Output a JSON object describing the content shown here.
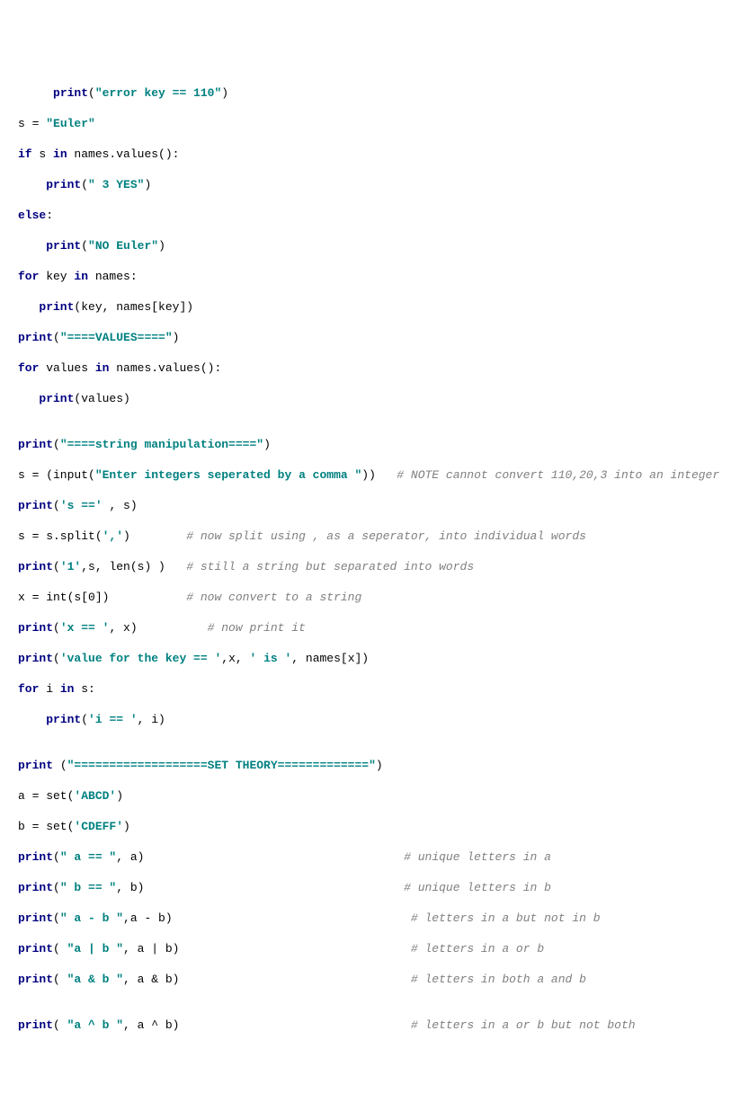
{
  "lines": {
    "l01_indent": "     ",
    "l01_print": "print",
    "l01_p1": "(",
    "l01_str": "\"error key == 110\"",
    "l01_p2": ")",
    "l02_s": "s ",
    "l02_eq": "= ",
    "l02_str": "\"Euler\"",
    "l03_if": "if",
    "l03_mid": " s ",
    "l03_in": "in",
    "l03_rest": " names.values():",
    "l04_indent": "    ",
    "l04_print": "print",
    "l04_p1": "(",
    "l04_str": "\" 3 YES\"",
    "l04_p2": ")",
    "l05_else": "else",
    "l05_colon": ":",
    "l06_indent": "    ",
    "l06_print": "print",
    "l06_p1": "(",
    "l06_str": "\"NO Euler\"",
    "l06_p2": ")",
    "l07_for": "for",
    "l07_mid": " key ",
    "l07_in": "in",
    "l07_rest": " names:",
    "l08_indent": "   ",
    "l08_print": "print",
    "l08_rest": "(key, names[key])",
    "l09_print": "print",
    "l09_p1": "(",
    "l09_str": "\"====VALUES====\"",
    "l09_p2": ")",
    "l10_for": "for",
    "l10_mid": " values ",
    "l10_in": "in",
    "l10_rest": " names.values():",
    "l11_indent": "   ",
    "l11_print": "print",
    "l11_rest": "(values)",
    "blank1": "",
    "l12_print": "print",
    "l12_p1": "(",
    "l12_str": "\"====string manipulation====\"",
    "l12_p2": ")",
    "l13_pre": "s = (input(",
    "l13_str": "\"Enter integers seperated by a comma \"",
    "l13_post": "))   ",
    "l13_cmt": "# NOTE cannot convert 110,20,3 into an integer",
    "l14_print": "print",
    "l14_p1": "(",
    "l14_str": "'s =='",
    "l14_rest": " , s)",
    "l15_pre": "s = s.split(",
    "l15_str": "','",
    "l15_post": ")        ",
    "l15_cmt": "# now split using , as a seperator, into individual words",
    "l16_print": "print",
    "l16_p1": "(",
    "l16_str": "'1'",
    "l16_rest": ",s, len(s) )   ",
    "l16_cmt": "# still a string but separated into words",
    "l17_pre": "x = int(s[",
    "l17_num": "0",
    "l17_post": "])           ",
    "l17_cmt": "# now convert to a string",
    "l18_print": "print",
    "l18_p1": "(",
    "l18_str": "'x == '",
    "l18_rest": ", x)          ",
    "l18_cmt": "# now print it",
    "l19_print": "print",
    "l19_p1": "(",
    "l19_str": "'value for the key == '",
    "l19_mid": ",x, ",
    "l19_str2": "' is '",
    "l19_rest": ", names[x])",
    "l20_for": "for",
    "l20_mid": " i ",
    "l20_in": "in",
    "l20_rest": " s:",
    "l21_indent": "    ",
    "l21_print": "print",
    "l21_p1": "(",
    "l21_str": "'i == '",
    "l21_rest": ", i)",
    "blank2": "",
    "l22_print": "print",
    "l22_sp": " (",
    "l22_str": "\"===================SET THEORY=============\"",
    "l22_p2": ")",
    "l23_pre": "a = set(",
    "l23_str": "'ABCD'",
    "l23_post": ")",
    "l24_pre": "b = set(",
    "l24_str": "'CDEFF'",
    "l24_post": ")",
    "l25_print": "print",
    "l25_p1": "(",
    "l25_str": "\" a == \"",
    "l25_rest": ", a)                                     ",
    "l25_cmt": "# unique letters in a",
    "l26_print": "print",
    "l26_p1": "(",
    "l26_str": "\" b == \"",
    "l26_rest": ", b)                                     ",
    "l26_cmt": "# unique letters in b",
    "l27_print": "print",
    "l27_p1": "(",
    "l27_str": "\" a - b \"",
    "l27_rest": ",a - b)                                  ",
    "l27_cmt": "# letters in a but not in b",
    "l28_print": "print",
    "l28_p1": "( ",
    "l28_str": "\"a | b \"",
    "l28_rest": ", a | b)                                 ",
    "l28_cmt": "# letters in a or b",
    "l29_print": "print",
    "l29_p1": "( ",
    "l29_str": "\"a & b \"",
    "l29_rest": ", a & b)                                 ",
    "l29_cmt": "# letters in both a and b",
    "blank3": "",
    "l30_print": "print",
    "l30_p1": "( ",
    "l30_str": "\"a ^ b \"",
    "l30_rest": ", a ^ b)                                 ",
    "l30_cmt": "# letters in a or b but not both"
  }
}
